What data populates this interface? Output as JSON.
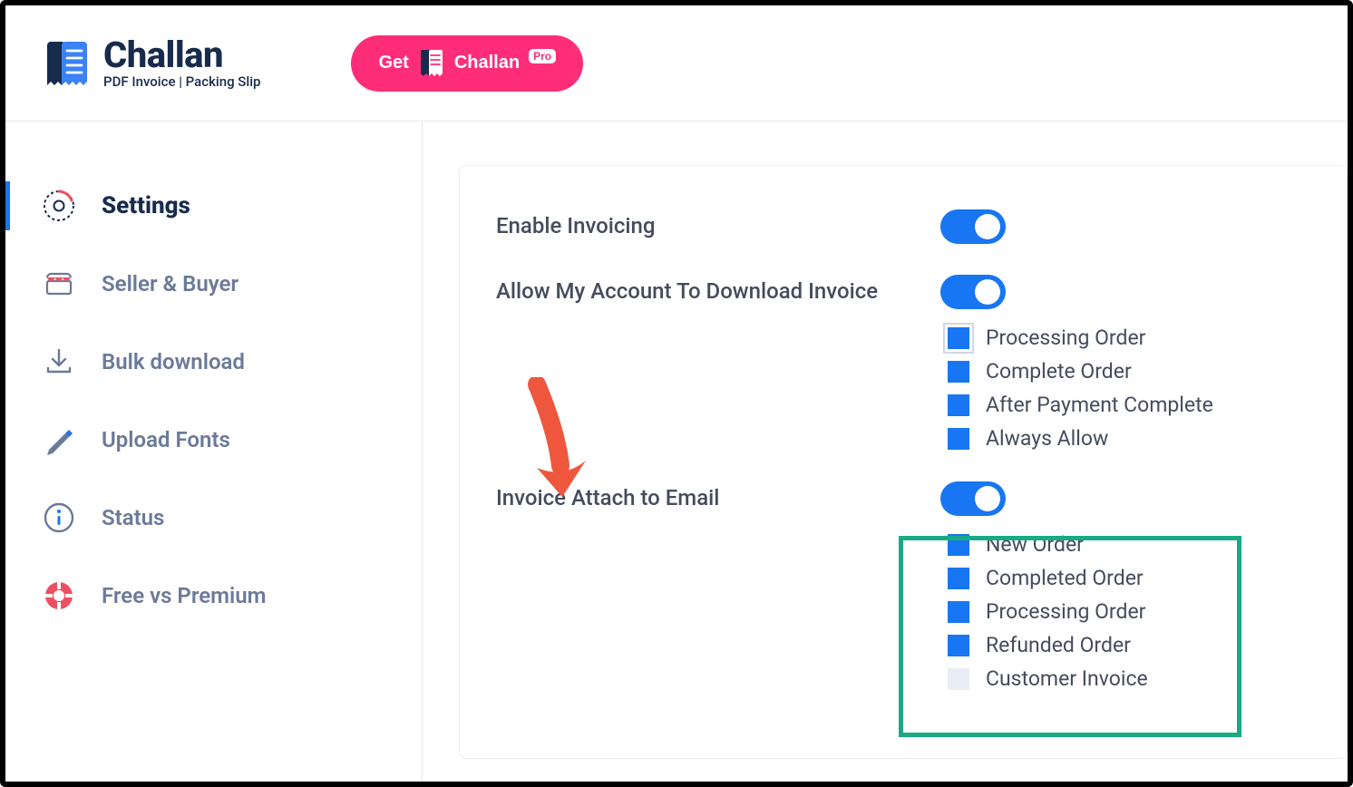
{
  "brand": {
    "name": "Challan",
    "tagline": "PDF Invoice | Packing Slip"
  },
  "header": {
    "get_label": "Get",
    "pro_label": "Challan",
    "pro_badge": "Pro"
  },
  "sidebar": {
    "items": [
      {
        "label": "Settings",
        "icon": "gear"
      },
      {
        "label": "Seller & Buyer",
        "icon": "store"
      },
      {
        "label": "Bulk download",
        "icon": "download"
      },
      {
        "label": "Upload Fonts",
        "icon": "pen"
      },
      {
        "label": "Status",
        "icon": "info"
      },
      {
        "label": "Free vs Premium",
        "icon": "lifebuoy"
      }
    ],
    "active_index": 0
  },
  "settings": {
    "enable_invoicing": {
      "label": "Enable Invoicing",
      "value": true
    },
    "allow_download": {
      "label": "Allow My Account To Download Invoice",
      "value": true
    },
    "download_options": [
      {
        "label": "Processing Order",
        "checked": true,
        "outlined": true
      },
      {
        "label": "Complete Order",
        "checked": true
      },
      {
        "label": "After Payment Complete",
        "checked": true
      },
      {
        "label": "Always Allow",
        "checked": true
      }
    ],
    "attach_email": {
      "label": "Invoice Attach to Email",
      "value": true
    },
    "email_options": [
      {
        "label": "New Order",
        "checked": true
      },
      {
        "label": "Completed Order",
        "checked": true
      },
      {
        "label": "Processing Order",
        "checked": true
      },
      {
        "label": "Refunded Order",
        "checked": true
      },
      {
        "label": "Customer Invoice",
        "checked": false
      }
    ]
  },
  "colors": {
    "accent": "#1876f2",
    "pink": "#ff2d78",
    "highlight": "#18a985",
    "arrow": "#ee573d"
  }
}
